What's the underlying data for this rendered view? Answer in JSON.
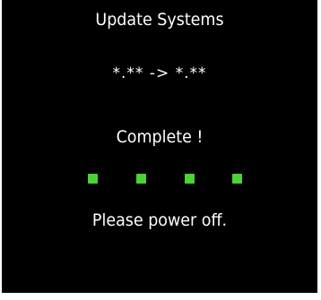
{
  "screen": {
    "title": "Update Systems",
    "version_text": "*.** -> *.**",
    "status": "Complete !",
    "progress": {
      "steps_total": 4,
      "steps_complete": 4,
      "indicator_color": "#4cd233"
    },
    "message": "Please power off.",
    "background_color": "#000000",
    "text_color": "#ffffff"
  }
}
